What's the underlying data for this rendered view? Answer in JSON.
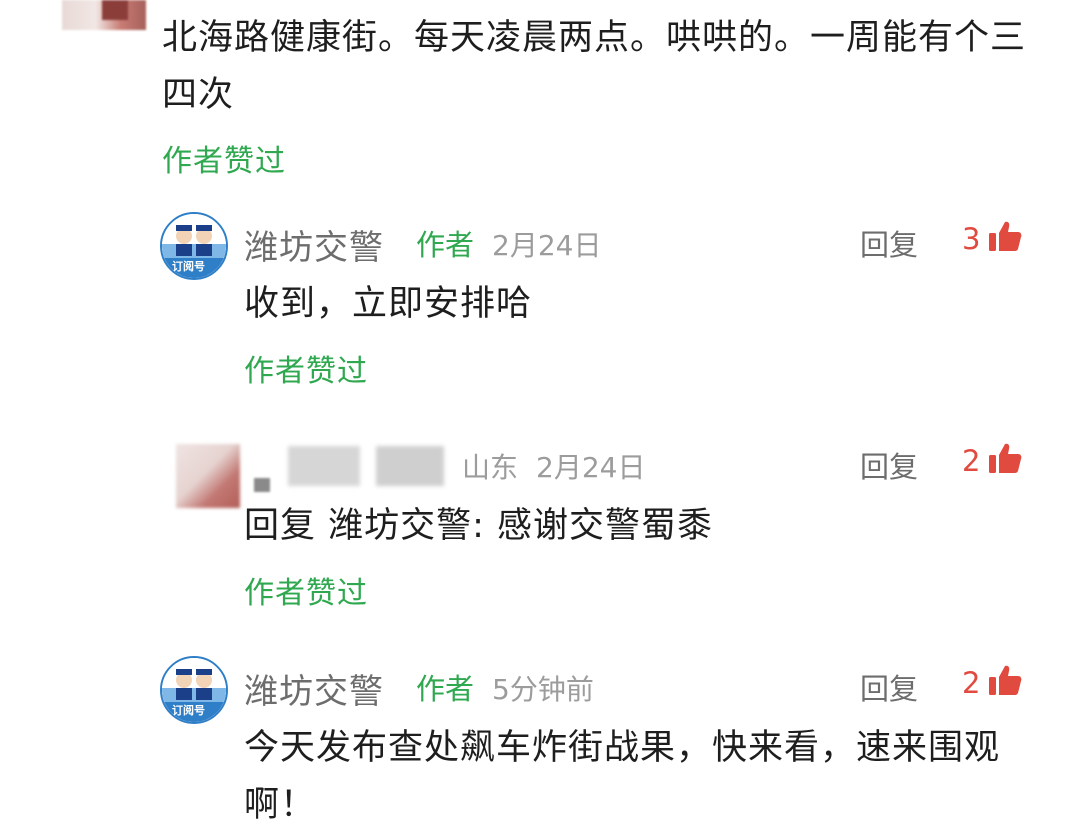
{
  "comment_top": {
    "text": "北海路健康街。每天凌晨两点。哄哄的。一周能有个三四次",
    "author_liked": "作者赞过"
  },
  "replies": [
    {
      "author": "潍坊交警",
      "tag": "作者",
      "time": "2月24日",
      "reply_label": "回复",
      "likes": "3",
      "text": "收到，立即安排哈",
      "author_liked": "作者赞过",
      "avatar_badge": "订阅号"
    },
    {
      "author": "",
      "location": "山东",
      "time": "2月24日",
      "reply_label": "回复",
      "likes": "2",
      "text": "回复 潍坊交警: 感谢交警蜀黍",
      "author_liked": "作者赞过"
    },
    {
      "author": "潍坊交警",
      "tag": "作者",
      "time": "5分钟前",
      "reply_label": "回复",
      "likes": "2",
      "text": "今天发布查处飙车炸街战果，快来看，速来围观啊！",
      "avatar_badge": "订阅号"
    }
  ],
  "colors": {
    "green": "#2fa84f",
    "like_red": "#e04a3f",
    "gray_text": "#6d6d6d",
    "time_gray": "#9c9c9c"
  },
  "icons": {
    "like": "thumbs-up-icon"
  }
}
